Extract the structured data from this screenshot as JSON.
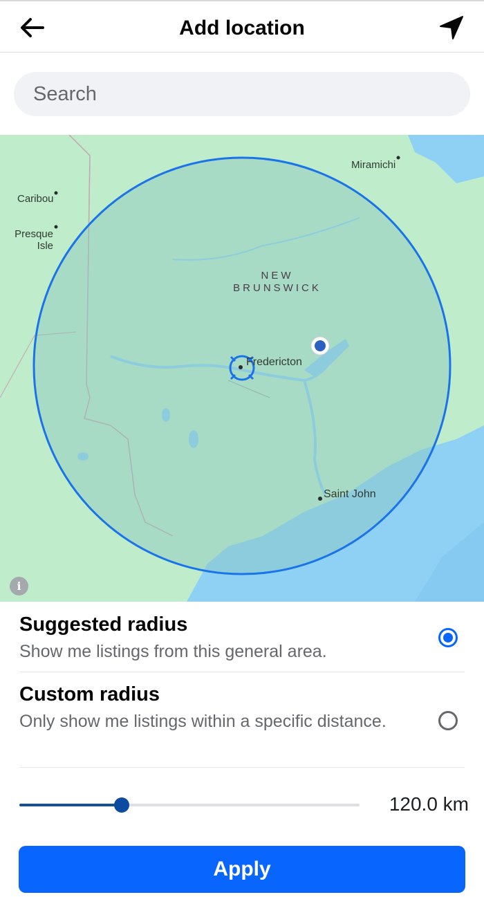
{
  "header": {
    "title": "Add location",
    "back_icon": "arrow-left-icon",
    "locate_icon": "navigation-arrow-icon"
  },
  "search": {
    "placeholder": "Search",
    "value": ""
  },
  "map": {
    "labels": {
      "miramichi": "Miramichi",
      "caribou": "Caribou",
      "presque_isle": "Presque\nIsle",
      "province": "NEW\nBRUNSWICK",
      "fredericton": "Fredericton",
      "saint_john": "Saint John"
    },
    "info_symbol": "i",
    "colors": {
      "land": "#bfeccb",
      "water": "#8fd0f5",
      "radius": "#1a73e8"
    }
  },
  "options": [
    {
      "title": "Suggested radius",
      "description": "Show me listings from this general area.",
      "selected": true
    },
    {
      "title": "Custom radius",
      "description": "Only show me listings within a specific distance.",
      "selected": false
    }
  ],
  "slider": {
    "fraction": 0.3,
    "value_text": "120.0 km"
  },
  "apply_label": "Apply",
  "accent_color": "#0866ff"
}
